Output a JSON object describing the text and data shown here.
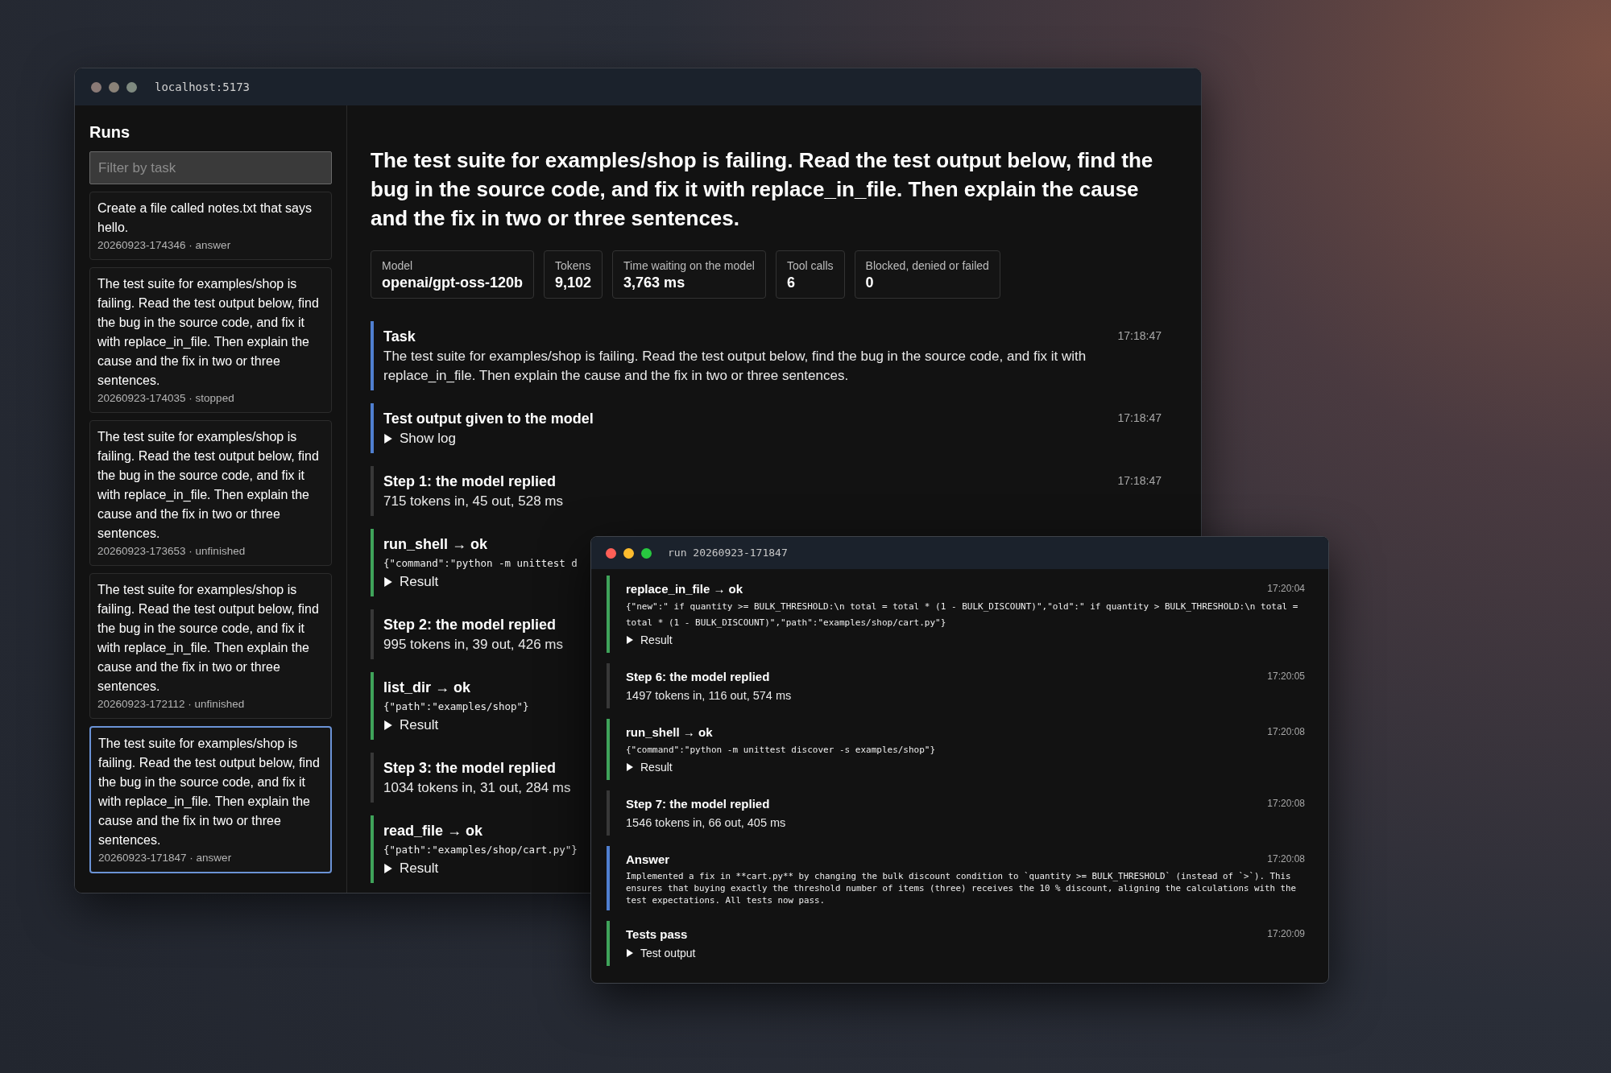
{
  "main_window": {
    "active": false,
    "address": "localhost:5173",
    "sidebar": {
      "title": "Runs",
      "filter": {
        "placeholder": "Filter by task"
      },
      "runs": [
        {
          "task": "Create a file called notes.txt that says hello.",
          "meta": "20260923-174346 · answer",
          "selected": false
        },
        {
          "task": "The test suite for examples/shop is failing. Read the test output below, find the bug in the source code, and fix it with replace_in_file. Then explain the cause and the fix in two or three sentences.",
          "meta": "20260923-174035 · stopped",
          "selected": false
        },
        {
          "task": "The test suite for examples/shop is failing. Read the test output below, find the bug in the source code, and fix it with replace_in_file. Then explain the cause and the fix in two or three sentences.",
          "meta": "20260923-173653 · unfinished",
          "selected": false
        },
        {
          "task": "The test suite for examples/shop is failing. Read the test output below, find the bug in the source code, and fix it with replace_in_file. Then explain the cause and the fix in two or three sentences.",
          "meta": "20260923-172112 · unfinished",
          "selected": false
        },
        {
          "task": "The test suite for examples/shop is failing. Read the test output below, find the bug in the source code, and fix it with replace_in_file. Then explain the cause and the fix in two or three sentences.",
          "meta": "20260923-171847 · answer",
          "selected": true
        }
      ]
    },
    "run": {
      "title": "The test suite for examples/shop is failing. Read the test output below, find the bug in the source code, and fix it with replace_in_file. Then explain the cause and the fix in two or three sentences.",
      "stats": [
        {
          "label": "Model",
          "value": "openai/gpt-oss-120b"
        },
        {
          "label": "Tokens",
          "value": "9,102"
        },
        {
          "label": "Time waiting on the model",
          "value": "3,763 ms"
        },
        {
          "label": "Tool calls",
          "value": "6"
        },
        {
          "label": "Blocked, denied or failed",
          "value": "0"
        }
      ],
      "events": [
        {
          "kind": "task",
          "title": "Task",
          "time": "17:18:47",
          "text": "The test suite for examples/shop is failing. Read the test output below, find the bug in the source code, and fix it with replace_in_file. Then explain the cause and the fix in two or three sentences."
        },
        {
          "kind": "task",
          "title": "Test output given to the model",
          "time": "17:18:47",
          "disclosure": "Show log"
        },
        {
          "kind": "step",
          "title": "Step 1: the model replied",
          "time": "17:18:47",
          "text": "715 tokens in, 45 out, 528 ms"
        },
        {
          "kind": "tool",
          "title": "run_shell → ok",
          "code": "{\"command\":\"python -m unittest d",
          "disclosure": "Result"
        },
        {
          "kind": "step",
          "title": "Step 2: the model replied",
          "text": "995 tokens in, 39 out, 426 ms"
        },
        {
          "kind": "tool",
          "title": "list_dir → ok",
          "code": "{\"path\":\"examples/shop\"}",
          "disclosure": "Result"
        },
        {
          "kind": "step",
          "title": "Step 3: the model replied",
          "text": "1034 tokens in, 31 out, 284 ms"
        },
        {
          "kind": "tool",
          "title": "read_file → ok",
          "code": "{\"path\":\"examples/shop/cart.py\"}",
          "disclosure": "Result"
        }
      ]
    }
  },
  "run_window": {
    "active": true,
    "title": "run 20260923-171847",
    "events": [
      {
        "kind": "tool",
        "title": "replace_in_file → ok",
        "time": "17:20:04",
        "code": "{\"new\":\" if quantity >= BULK_THRESHOLD:\\n total = total * (1 - BULK_DISCOUNT)\",\"old\":\" if quantity > BULK_THRESHOLD:\\n total = total * (1 - BULK_DISCOUNT)\",\"path\":\"examples/shop/cart.py\"}",
        "disclosure": "Result"
      },
      {
        "kind": "step",
        "title": "Step 6: the model replied",
        "time": "17:20:05",
        "text": "1497 tokens in, 116 out, 574 ms"
      },
      {
        "kind": "tool",
        "title": "run_shell → ok",
        "time": "17:20:08",
        "code": "{\"command\":\"python -m unittest discover -s examples/shop\"}",
        "disclosure": "Result"
      },
      {
        "kind": "step",
        "title": "Step 7: the model replied",
        "time": "17:20:08",
        "text": "1546 tokens in, 66 out, 405 ms"
      },
      {
        "kind": "answer",
        "title": "Answer",
        "time": "17:20:08",
        "code": "Implemented a fix in **cart.py** by changing the bulk discount condition to `quantity >= BULK_THRESHOLD` (instead of `>`). This ensures that buying exactly the threshold number of items (three) receives the 10 % discount, aligning the calculations with the test expectations. All tests now pass."
      },
      {
        "kind": "tests",
        "title": "Tests pass",
        "time": "17:20:09",
        "disclosure": "Test output"
      }
    ]
  }
}
